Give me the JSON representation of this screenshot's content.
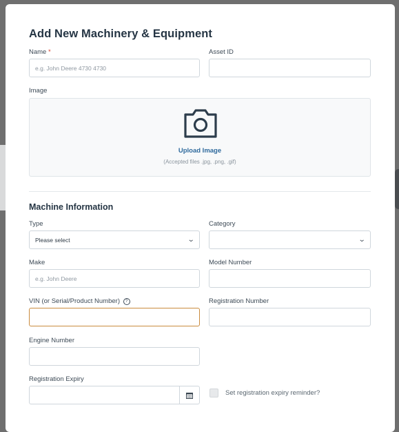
{
  "modal": {
    "title": "Add New Machinery & Equipment"
  },
  "fields": {
    "name": {
      "label": "Name",
      "required_mark": "*",
      "placeholder": "e.g. John Deere 4730 4730",
      "value": ""
    },
    "asset_id": {
      "label": "Asset ID",
      "value": ""
    },
    "image": {
      "label": "Image",
      "upload_label": "Upload Image",
      "hint": "(Accepted files .jpg, .png, .gif)"
    },
    "type": {
      "label": "Type",
      "selected": "Please select"
    },
    "category": {
      "label": "Category",
      "selected": ""
    },
    "make": {
      "label": "Make",
      "placeholder": "e.g. John Deere",
      "value": ""
    },
    "model_number": {
      "label": "Model Number",
      "value": ""
    },
    "vin": {
      "label": "VIN (or Serial/Product Number)",
      "help_glyph": "?",
      "value": ""
    },
    "registration_number": {
      "label": "Registration Number",
      "value": ""
    },
    "engine_number": {
      "label": "Engine Number",
      "value": ""
    },
    "registration_expiry": {
      "label": "Registration Expiry",
      "value": ""
    },
    "expiry_reminder": {
      "label": "Set registration expiry reminder?",
      "checked": false
    }
  },
  "sections": {
    "machine_information": "Machine Information"
  },
  "icons": {
    "camera": "camera-icon",
    "chevron": "chevron-down-icon",
    "calendar": "calendar-icon"
  },
  "colors": {
    "heading": "#253544",
    "link": "#2f6a9d",
    "required": "#d9432f",
    "focus_border": "#c98a3c"
  }
}
